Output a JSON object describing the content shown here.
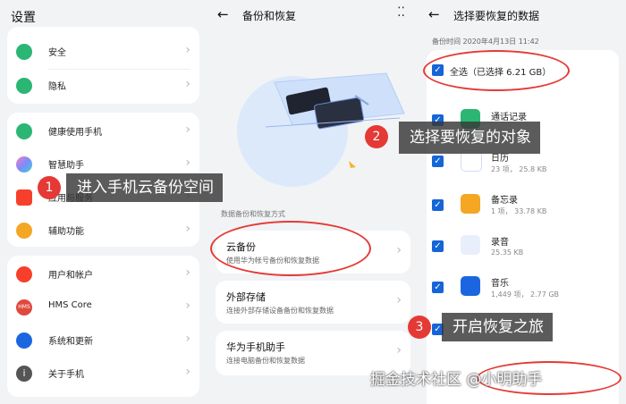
{
  "panel1": {
    "title": "设置",
    "groups": [
      {
        "items": [
          {
            "label": "安全",
            "icon": "shield-icon",
            "color": "#2bb673"
          },
          {
            "label": "隐私",
            "icon": "privacy-icon",
            "color": "#2bb673"
          }
        ]
      },
      {
        "items": [
          {
            "label": "健康使用手机",
            "icon": "hourglass-icon",
            "color": "#2bb673"
          },
          {
            "label": "智慧助手",
            "icon": "assistant-icon",
            "color": "#9c7bff"
          },
          {
            "label": "应用与服务",
            "icon": "apps-icon",
            "color": "#f6402b"
          },
          {
            "label": "辅助功能",
            "icon": "hand-icon",
            "color": "#f5a623"
          }
        ]
      },
      {
        "items": [
          {
            "label": "用户和帐户",
            "icon": "user-icon",
            "color": "#f6402b"
          },
          {
            "label": "HMS Core",
            "icon": "hms-icon",
            "color": "#e0483d"
          },
          {
            "label": "系统和更新",
            "icon": "system-icon",
            "color": "#1b66e0"
          },
          {
            "label": "关于手机",
            "icon": "info-icon",
            "color": "#555555"
          }
        ]
      }
    ],
    "annotation": {
      "number": "1",
      "text": "进入手机云备份空间"
    }
  },
  "panel2": {
    "title": "备份和恢复",
    "menu_icon": "⁚⁚",
    "section_label": "数据备份和恢复方式",
    "options": [
      {
        "title": "云备份",
        "desc": "使用华为帐号备份和恢复数据"
      },
      {
        "title": "外部存储",
        "desc": "连接外部存储设备备份和恢复数据"
      },
      {
        "title": "华为手机助手",
        "desc": "连接电脑备份和恢复数据"
      }
    ],
    "annotation": {
      "number": "2",
      "text": "选择要恢复的对象"
    }
  },
  "panel3": {
    "title": "选择要恢复的数据",
    "backup_time": "备份时间 2020年4月13日 11:42",
    "select_all": "全选（已选择 6.21 GB）",
    "items": [
      {
        "name": "通话记录",
        "meta": "",
        "icon": "phone-icon",
        "color": "#2bb673"
      },
      {
        "name": "日历",
        "meta": "23 项， 25.8 KB",
        "icon": "calendar-icon",
        "color": "#1b66e0"
      },
      {
        "name": "备忘录",
        "meta": "1 项， 33.78 KB",
        "icon": "notes-icon",
        "color": "#f5a623"
      },
      {
        "name": "录音",
        "meta": "25.35 KB",
        "icon": "recorder-icon",
        "color": "#1b66e0"
      },
      {
        "name": "音乐",
        "meta": "1,449 项， 2.77 GB",
        "icon": "music-icon",
        "color": "#1b66e0"
      }
    ],
    "annotation": {
      "number": "3",
      "text": "开启恢复之旅"
    }
  },
  "watermark": "掘金技术社区 @小明助手"
}
